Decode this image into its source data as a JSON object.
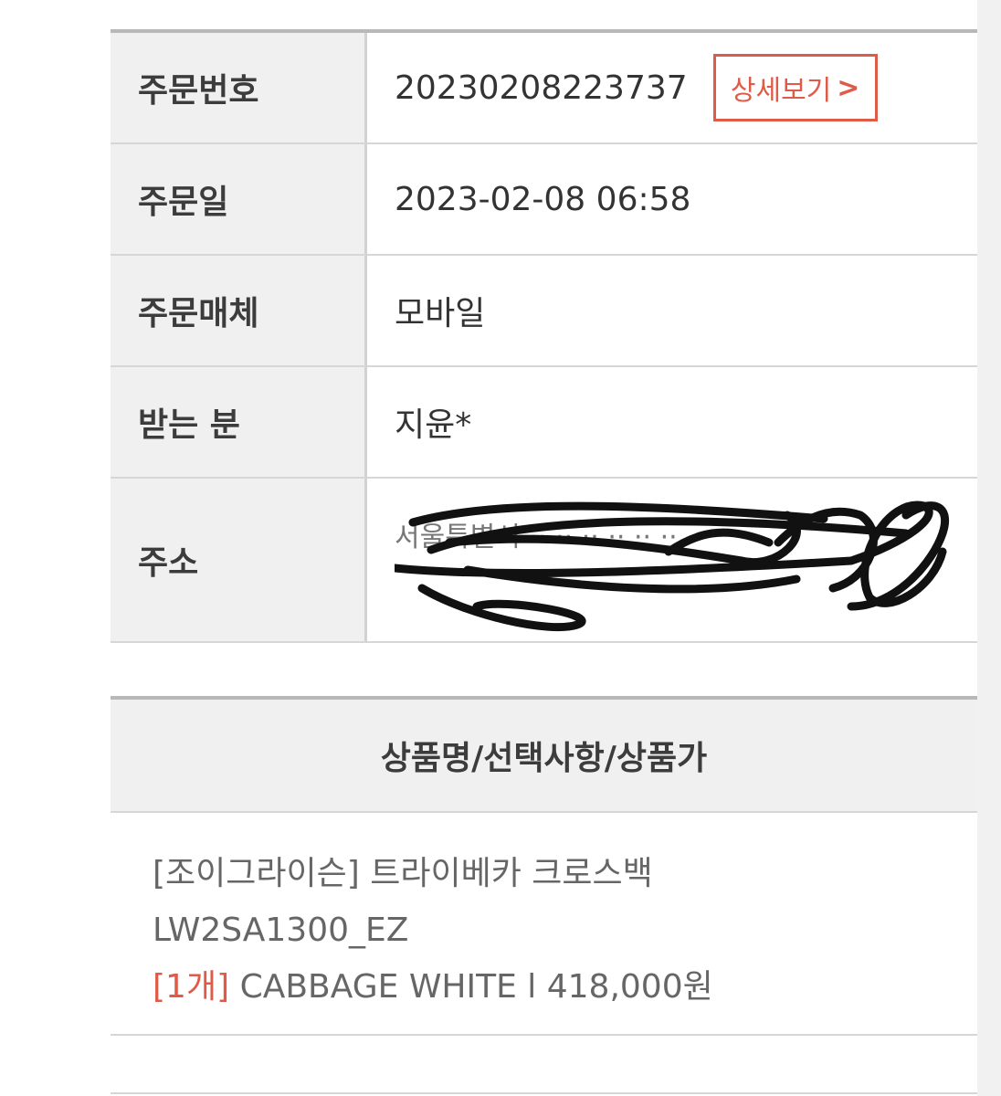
{
  "order": {
    "number_label": "주문번호",
    "number_value": "20230208223737",
    "detail_button": "상세보기",
    "detail_arrow": ">",
    "date_label": "주문일",
    "date_value": "2023-02-08 06:58",
    "channel_label": "주문매체",
    "channel_value": "모바일",
    "recipient_label": "받는 분",
    "recipient_value": "지윤*",
    "address_label": "주소",
    "address_value": "서울특별시 ·· ·· ·· ·· ·· ··"
  },
  "product": {
    "header": "상품명/선택사항/상품가",
    "name_line1": "[조이그라이슨] 트라이베카 크로스백",
    "name_line2": "LW2SA1300_EZ",
    "quantity": "[1개]",
    "option_price": "CABBAGE WHITE l 418,000원"
  },
  "colors": {
    "accent": "#e05a48",
    "header_bg": "#f0f0f0",
    "border": "#d6d6d6"
  }
}
